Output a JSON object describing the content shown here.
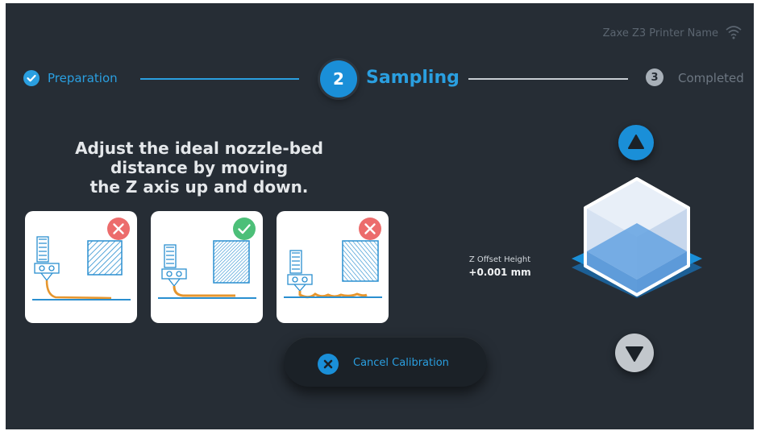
{
  "header": {
    "printer_name": "Zaxe Z3 Printer Name",
    "wifi_icon": "wifi-icon"
  },
  "stepper": {
    "steps": [
      {
        "number": "",
        "label": "Preparation",
        "state": "completed",
        "icon": "check-circle-icon"
      },
      {
        "number": "2",
        "label": "Sampling",
        "state": "active"
      },
      {
        "number": "3",
        "label": "Completed",
        "state": "pending"
      }
    ]
  },
  "instruction": "Adjust the ideal nozzle-bed\ndistance by moving\nthe Z axis up and down.",
  "examples": [
    {
      "status": "incorrect",
      "icon": "x-circle-icon",
      "color": "#ec6c6c"
    },
    {
      "status": "correct",
      "icon": "check-circle-icon",
      "color": "#4cbf78"
    },
    {
      "status": "incorrect",
      "icon": "x-circle-icon",
      "color": "#ec6c6c"
    }
  ],
  "z_offset": {
    "label": "Z Offset Height",
    "value": "+0.001 mm"
  },
  "controls": {
    "up_icon": "triangle-up-icon",
    "down_icon": "triangle-down-icon"
  },
  "cancel_button": {
    "label": "Cancel Calibration",
    "icon": "x-circle-icon"
  },
  "colors": {
    "background": "#262d35",
    "accent": "#1a8fd8",
    "filament": "#e6962e",
    "error": "#ec6c6c",
    "success": "#4cbf78"
  }
}
